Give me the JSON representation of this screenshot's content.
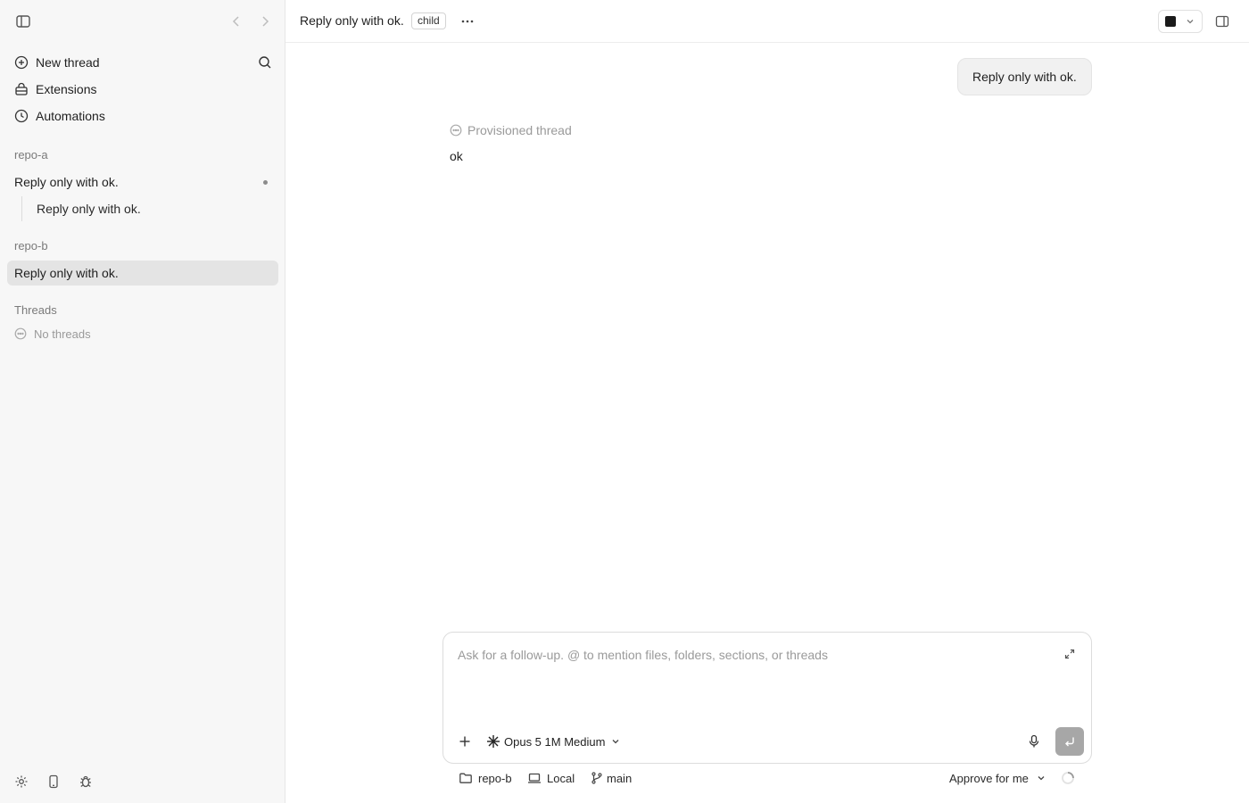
{
  "sidebar": {
    "menu": [
      {
        "label": "New thread",
        "icon": "plus-circle-icon"
      },
      {
        "label": "Extensions",
        "icon": "extensions-icon"
      },
      {
        "label": "Automations",
        "icon": "clock-icon"
      }
    ],
    "groups": [
      {
        "name": "repo-a",
        "threads": [
          {
            "title": "Reply only with ok.",
            "unread": true
          }
        ],
        "children": [
          {
            "title": "Reply only with ok."
          }
        ]
      },
      {
        "name": "repo-b",
        "threads": [
          {
            "title": "Reply only with ok.",
            "active": true
          }
        ]
      }
    ],
    "threads_section": {
      "label": "Threads",
      "empty_text": "No threads"
    }
  },
  "header": {
    "title": "Reply only with ok.",
    "badge": "child"
  },
  "conversation": {
    "user_message": "Reply only with ok.",
    "status_label": "Provisioned thread",
    "assistant_reply": "ok"
  },
  "composer": {
    "placeholder": "Ask for a follow-up. @ to mention files, folders, sections, or threads",
    "value": "",
    "model": "Opus 5 1M Medium"
  },
  "footer": {
    "folder": "repo-b",
    "environment": "Local",
    "branch": "main",
    "approval": "Approve for me"
  },
  "colors": {
    "sidebar_bg": "#f7f7f7",
    "active_row": "#e4e4e4",
    "send_button": "#a7a7a7"
  }
}
